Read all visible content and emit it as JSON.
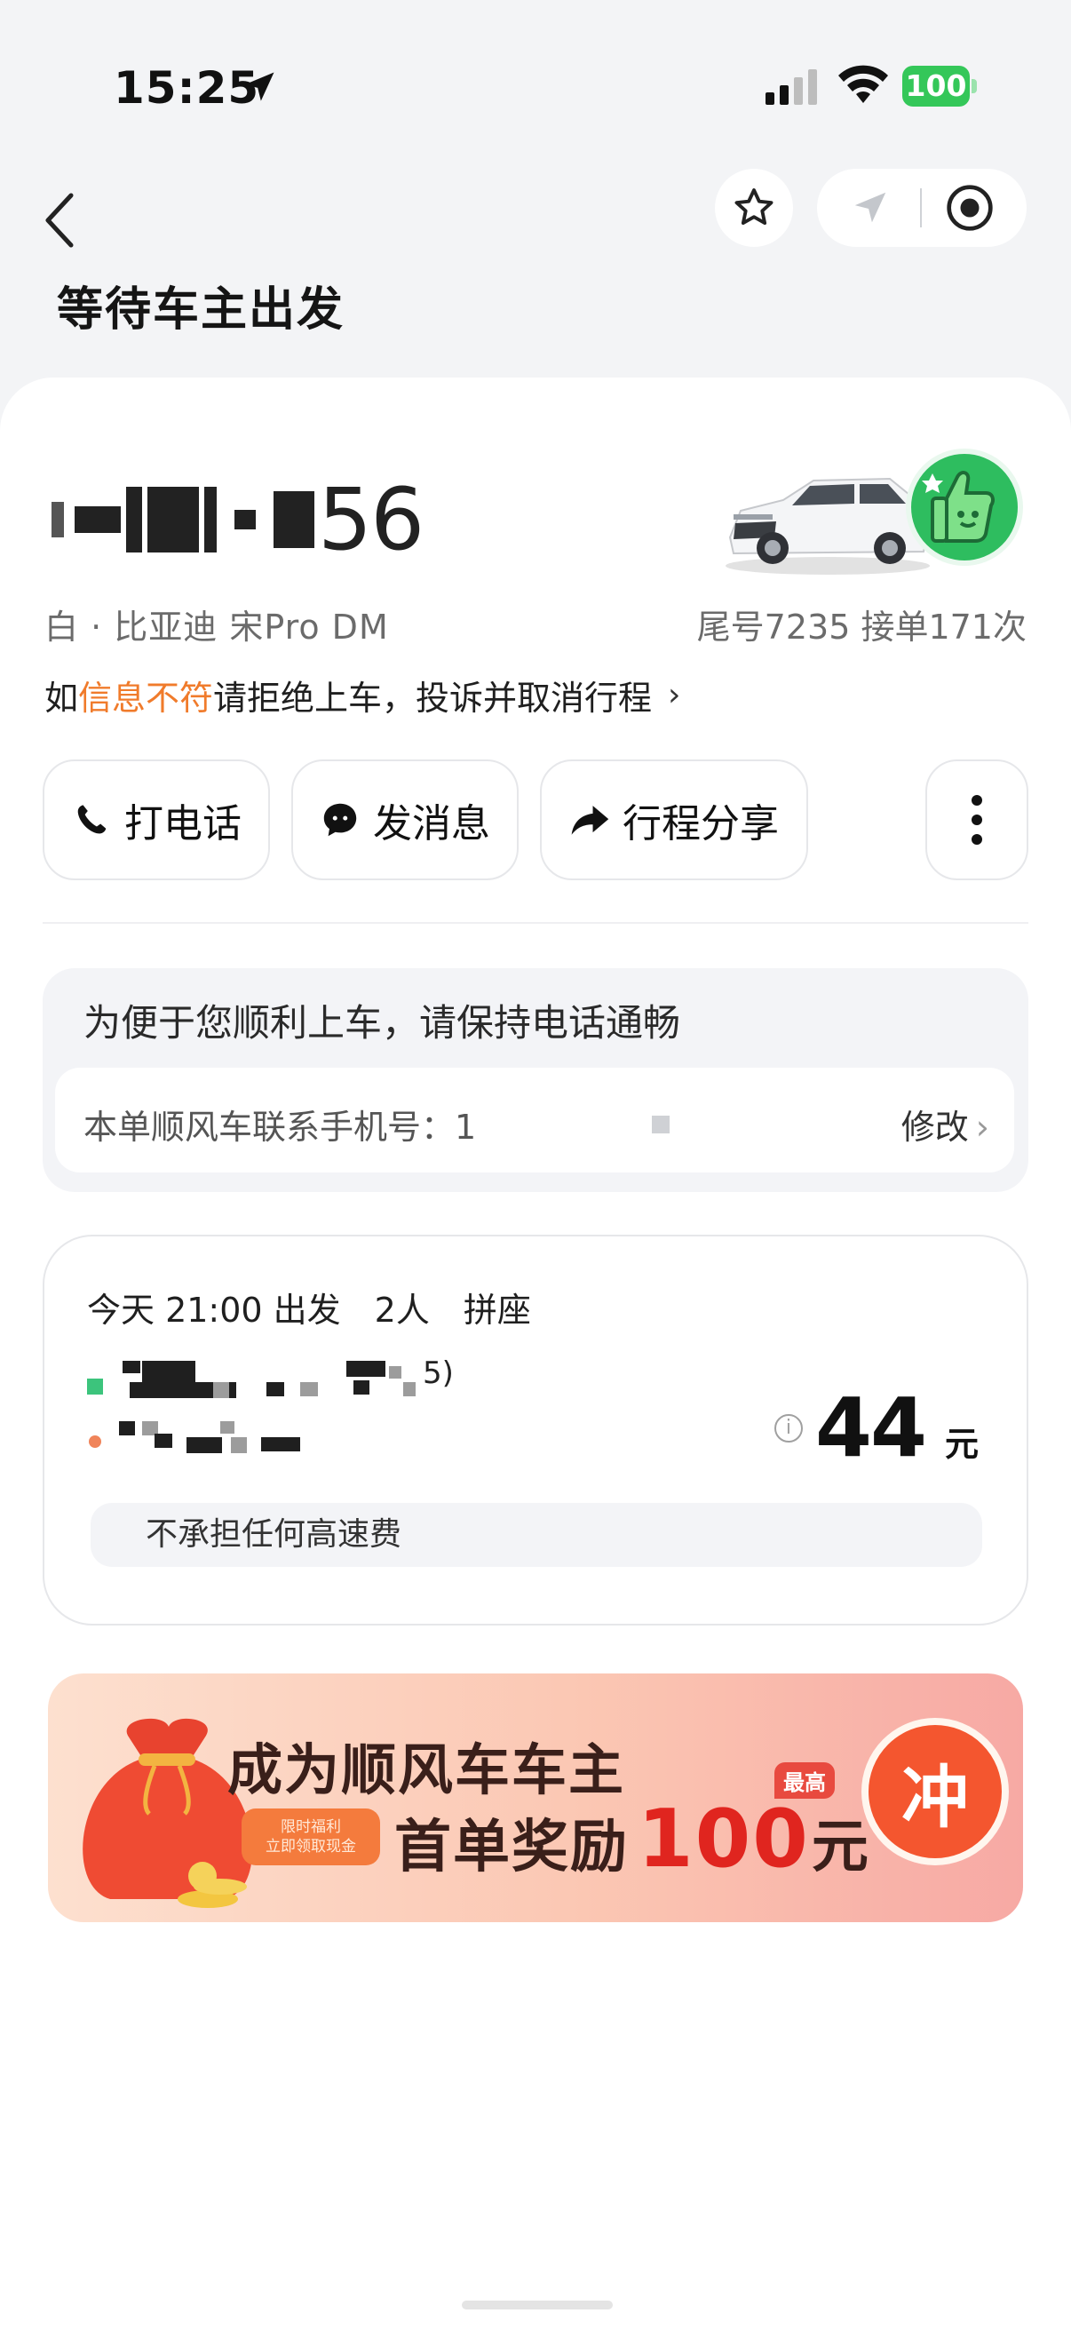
{
  "status_bar": {
    "time": "15:25",
    "battery": "100"
  },
  "header": {
    "title": "等待车主出发"
  },
  "driver": {
    "plate_visible": "56",
    "car_info": "白 · 比亚迪 宋Pro DM",
    "stats": "尾号7235 接单171次",
    "warning_prefix": "如",
    "warning_highlight": "信息不符",
    "warning_suffix": "请拒绝上车，投诉并取消行程",
    "warning_arrow": "›"
  },
  "actions": {
    "call": "打电话",
    "message": "发消息",
    "share": "行程分享"
  },
  "phone": {
    "tip": "为便于您顺利上车，请保持电话通畅",
    "label": "本单顺风车联系手机号：1",
    "edit": "修改",
    "edit_chev": "›"
  },
  "trip": {
    "time": "今天 21:00 出发",
    "people": "2人",
    "mode": "拼座",
    "start_tail": "5)",
    "price_info": "i",
    "price": "44",
    "unit": "元",
    "fee_note": "不承担任何高速费"
  },
  "banner": {
    "title": "成为顺风车车主",
    "tag": "限时福利\n立即领取现金",
    "reward_label": "首单奖励",
    "reward_amount": "100",
    "reward_unit": "元",
    "badge": "最高",
    "cta": "冲"
  },
  "colors": {
    "accent_orange": "#f07b2b",
    "green": "#34c759",
    "banner_red": "#e0251f"
  }
}
